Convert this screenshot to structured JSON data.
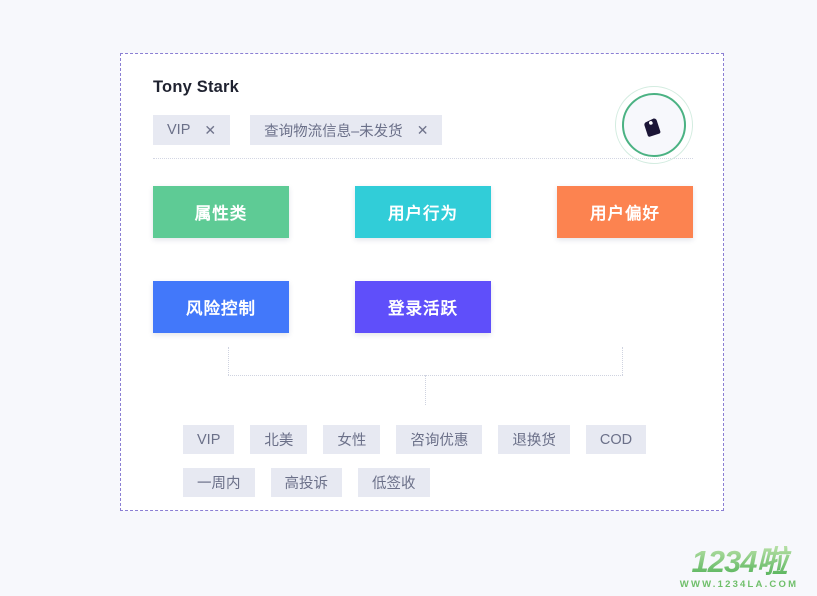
{
  "page": {
    "background_color": "#f7f8fc",
    "panel_background": "#ffffff",
    "panel_border_color": "#8b7fd4"
  },
  "header": {
    "user_name": "Tony Stark",
    "chips": [
      {
        "label": "VIP",
        "close_icon": "close-icon",
        "close_glyph": "✕"
      },
      {
        "label": "查询物流信息–未发货",
        "close_icon": "close-icon",
        "close_glyph": "✕"
      }
    ],
    "medallion": {
      "icon": "price-tag-icon",
      "ring_color": "#4bb283",
      "outer_ring_color": "#d3ece0",
      "icon_color": "#1b1536"
    }
  },
  "categories": {
    "row1": [
      {
        "label": "属性类",
        "color": "#5ecb95"
      },
      {
        "label": "用户行为",
        "color": "#31cdd8"
      },
      {
        "label": "用户偏好",
        "color": "#fc8350"
      }
    ],
    "row2": [
      {
        "label": "风险控制",
        "color": "#4278fa"
      },
      {
        "label": "登录活跃",
        "color": "#5f4ffa"
      }
    ]
  },
  "tags": {
    "chip_background": "#e7e9f2",
    "chip_text_color": "#6b7089",
    "items": [
      "VIP",
      "北美",
      "女性",
      "咨询优惠",
      "退换货",
      "COD",
      "一周内",
      "高投诉",
      "低签收"
    ]
  },
  "watermark": {
    "logo_text": "1234啦",
    "url_text": "WWW.1234LA.COM",
    "color": "#6fbf6a"
  }
}
